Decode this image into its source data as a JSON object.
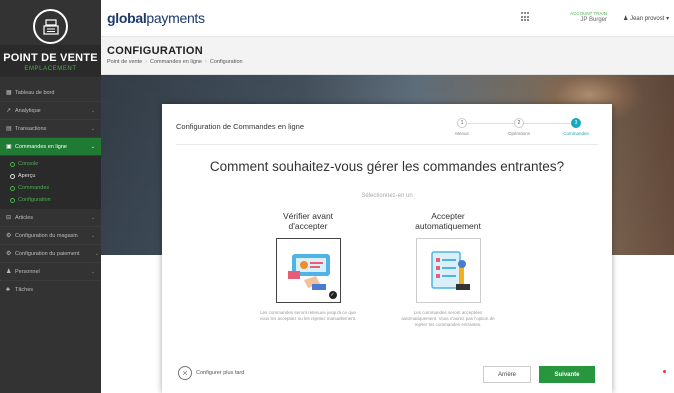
{
  "sidebar": {
    "brand_title": "POINT DE VENTE",
    "brand_subtitle": "EMPLACEMENT",
    "items": [
      {
        "icon": "dashboard-icon",
        "label": "Tableau de bord"
      },
      {
        "icon": "chart-icon",
        "label": "Analytique"
      },
      {
        "icon": "transactions-icon",
        "label": "Transactions"
      },
      {
        "icon": "cart-icon",
        "label": "Commandes en ligne"
      }
    ],
    "subitems": [
      "Console",
      "Aperçu",
      "Commandes",
      "Configuration"
    ],
    "items_after": [
      {
        "icon": "articles-icon",
        "label": "Articles"
      },
      {
        "icon": "store-config-icon",
        "label": "Configuration du magasin"
      },
      {
        "icon": "payment-config-icon",
        "label": "Configuration du paiement"
      },
      {
        "icon": "staff-icon",
        "label": "Personnel"
      },
      {
        "icon": "tasks-icon",
        "label": "Tâches"
      }
    ]
  },
  "header": {
    "logo_bold": "global",
    "logo_light": "payments",
    "account_label": "ACCOUNT TRAIN",
    "account_name": "JP Burger",
    "user_name": "Jean provost"
  },
  "page": {
    "title": "CONFIGURATION",
    "breadcrumbs": [
      "Point de vente",
      "Commandes en ligne",
      "Configuration"
    ]
  },
  "modal": {
    "title": "Configuration de Commandes en ligne",
    "steps": [
      {
        "num": "1",
        "label": "Menus"
      },
      {
        "num": "2",
        "label": "Opérations"
      },
      {
        "num": "3",
        "label": "Commandes"
      }
    ],
    "question": "Comment souhaitez-vous gérer les commandes entrantes?",
    "hint": "Sélectionnez-en un",
    "options": [
      {
        "title_1": "Vérifier avant",
        "title_2": "d'accepter",
        "description": "Les commandes seront retenues jusqu'à ce que vous les acceptiez ou les rejetiez manuellement."
      },
      {
        "title_1": "Accepter",
        "title_2": "automatiquement",
        "description": "Les commandes seront acceptées automatiquement. Vous n'aurez pas l'option de rejeter les commandes entrantes."
      }
    ],
    "later_label": "Configurer plus tard",
    "back_label": "Arrière",
    "next_label": "Suivante"
  },
  "colors": {
    "accent_green": "#27963f",
    "step_active": "#16a9b9",
    "sidebar_bg": "#333333"
  }
}
